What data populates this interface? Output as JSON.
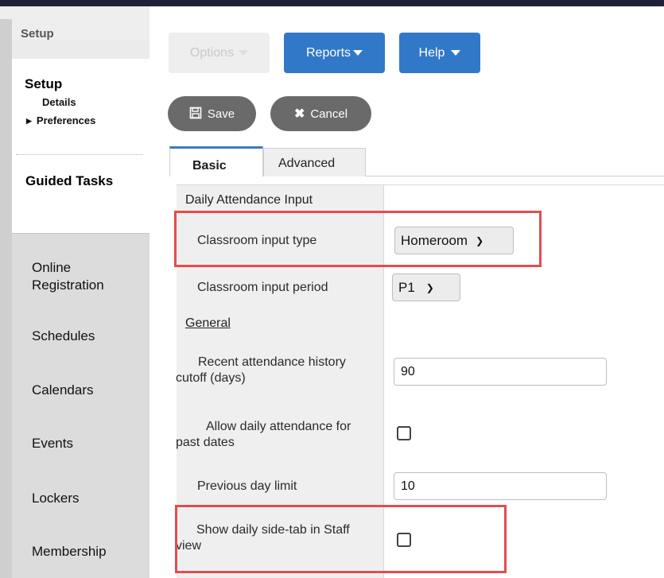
{
  "sidebar": {
    "header": "Setup",
    "setup_title": "Setup",
    "setup_items": [
      "Details",
      "Preferences"
    ],
    "guided_tasks": "Guided Tasks",
    "nav_items": [
      "Online Registration",
      "Schedules",
      "Calendars",
      "Events",
      "Lockers",
      "Membership"
    ]
  },
  "toolbar": {
    "options_label": "Options",
    "reports_label": "Reports",
    "help_label": "Help",
    "save_label": "Save",
    "cancel_label": "Cancel"
  },
  "tabs": [
    "Basic",
    "Advanced"
  ],
  "form": {
    "section_daily": "Daily Attendance Input",
    "classroom_input_type": {
      "label": "Classroom input type",
      "value": "Homeroom"
    },
    "classroom_input_period": {
      "label": "Classroom input period",
      "value": "P1"
    },
    "section_general": "General",
    "recent_cutoff": {
      "label": "Recent attendance history cutoff (days)",
      "value": "90"
    },
    "allow_past": {
      "label": "Allow daily attendance for past dates",
      "checked": false
    },
    "previous_day_limit": {
      "label": "Previous day limit",
      "value": "10"
    },
    "show_side_tab": {
      "label": "Show daily side-tab in Staff view",
      "checked": false
    }
  },
  "colors": {
    "accent": "#3278c8",
    "highlight": "#e04e4e"
  }
}
